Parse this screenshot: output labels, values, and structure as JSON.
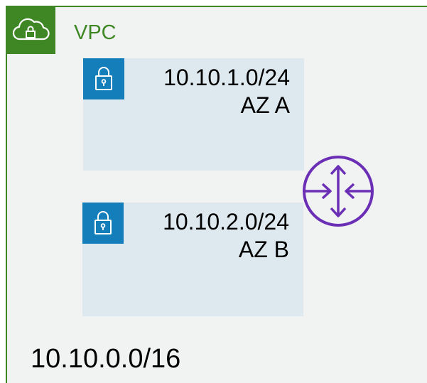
{
  "vpc": {
    "label": "VPC",
    "cidr": "10.10.0.0/16",
    "icon": "cloud-lock-icon",
    "color": "#3f8624"
  },
  "subnets": [
    {
      "cidr": "10.10.1.0/24",
      "az": "AZ A",
      "icon": "lock-icon"
    },
    {
      "cidr": "10.10.2.0/24",
      "az": "AZ B",
      "icon": "lock-icon"
    }
  ],
  "router": {
    "icon": "router-icon",
    "color": "#6b2fb5"
  },
  "colors": {
    "vpc_fill": "#f1f3f3",
    "subnet_fill": "#dde9ee",
    "subnet_badge": "#147eba"
  }
}
